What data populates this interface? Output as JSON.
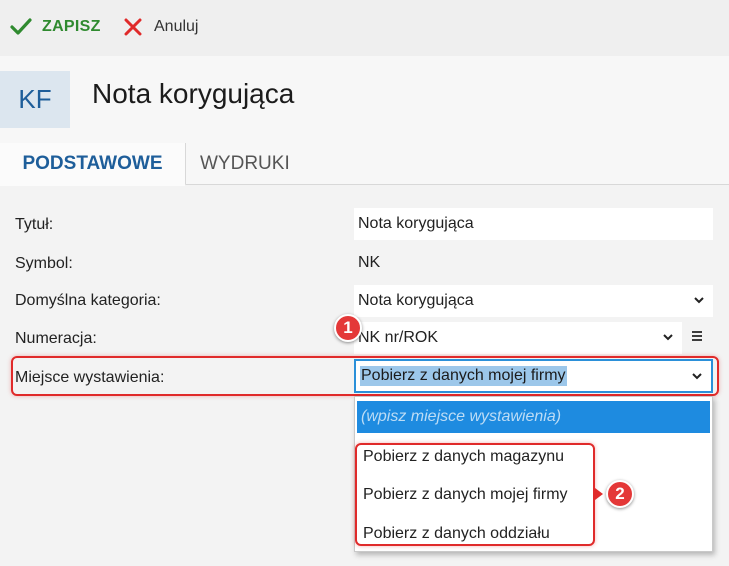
{
  "toolbar": {
    "save_label": "ZAPISZ",
    "cancel_label": "Anuluj"
  },
  "header": {
    "badge": "KF",
    "title": "Nota korygująca"
  },
  "tabs": [
    {
      "label": "PODSTAWOWE",
      "active": true
    },
    {
      "label": "WYDRUKI",
      "active": false
    }
  ],
  "form": {
    "title_label": "Tytuł:",
    "title_value": "Nota korygująca",
    "symbol_label": "Symbol:",
    "symbol_value": "NK",
    "category_label": "Domyślna kategoria:",
    "category_value": "Nota korygująca",
    "numbering_label": "Numeracja:",
    "numbering_value": "NK nr/ROK",
    "place_label": "Miejsce wystawienia:",
    "place_value": "Pobierz z danych mojej firmy"
  },
  "dropdown": {
    "placeholder": "(wpisz miejsce wystawienia)",
    "options": [
      "Pobierz z danych magazynu",
      "Pobierz z danych mojej firmy",
      "Pobierz z danych oddziału"
    ]
  },
  "annotations": {
    "marker_1": "1",
    "marker_2": "2"
  },
  "colors": {
    "accent": "#1e5e9a",
    "save_green": "#2f8a2f",
    "cancel_red": "#e02a2a",
    "highlight": "#e02a2a",
    "selection_blue": "#1e8be0"
  }
}
